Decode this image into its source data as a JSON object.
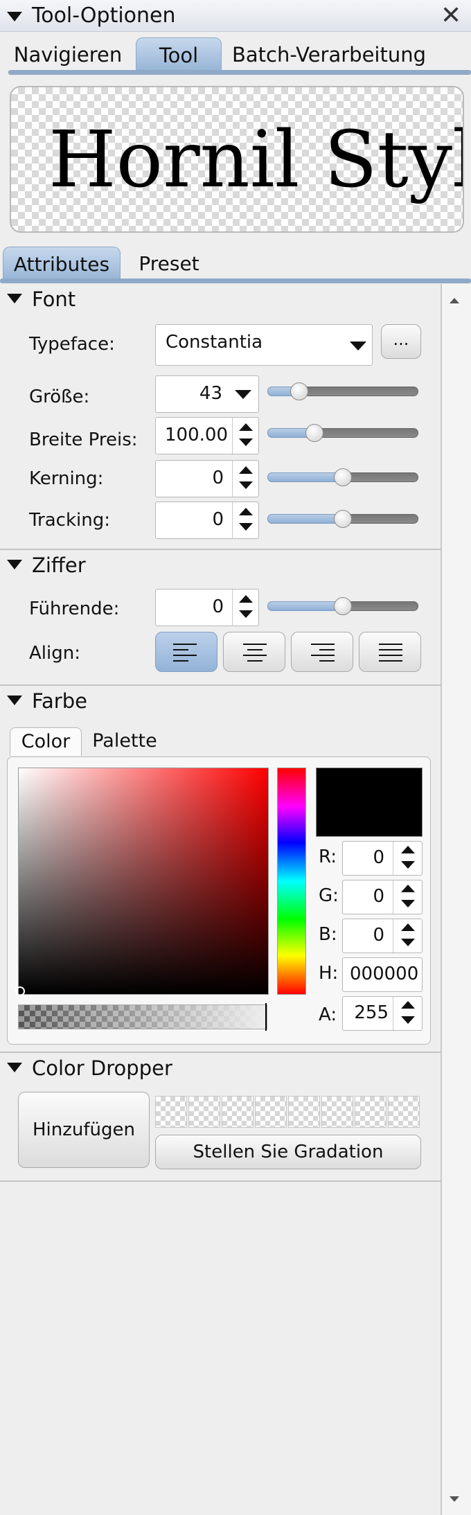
{
  "window": {
    "title": "Tool-Optionen",
    "close_icon": "close-icon"
  },
  "top_tabs": {
    "items": [
      "Navigieren",
      "Tool",
      "Batch-Verarbeitung"
    ],
    "active": "Tool"
  },
  "preview": {
    "text": "Hornil StyleP"
  },
  "sub_tabs": {
    "items": [
      "Attributes",
      "Preset"
    ],
    "active": "Attributes"
  },
  "font_section": {
    "title": "Font",
    "typeface_label": "Typeface:",
    "typeface_value": "Constantia",
    "browse_label": "...",
    "size_label": "Größe:",
    "size_value": "43",
    "size_slider": 0.21,
    "width_label": "Breite Preis:",
    "width_value": "100.00",
    "width_slider": 0.31,
    "kerning_label": "Kerning:",
    "kerning_value": "0",
    "kerning_slider": 0.5,
    "tracking_label": "Tracking:",
    "tracking_value": "0",
    "tracking_slider": 0.5
  },
  "figure_section": {
    "title": "Ziffer",
    "leading_label": "Führende:",
    "leading_value": "0",
    "leading_slider": 0.5,
    "align_label": "Align:",
    "align_options": [
      "left",
      "center",
      "right",
      "justify"
    ],
    "align_active": "left"
  },
  "color_section": {
    "title": "Farbe",
    "tabs": [
      "Color",
      "Palette"
    ],
    "active_tab": "Color",
    "current_color": "#000000",
    "r_label": "R:",
    "r_value": "0",
    "g_label": "G:",
    "g_value": "0",
    "b_label": "B:",
    "b_value": "0",
    "h_label": "H:",
    "h_value": "000000",
    "a_label": "A:",
    "a_value": "255"
  },
  "dropper_section": {
    "title": "Color Dropper",
    "add_label": "Hinzufügen",
    "gradation_label": "Stellen Sie Gradation",
    "slot_count": 8
  },
  "colors": {
    "accent": "#95b4d6",
    "accent_line": "#8eaac8"
  }
}
